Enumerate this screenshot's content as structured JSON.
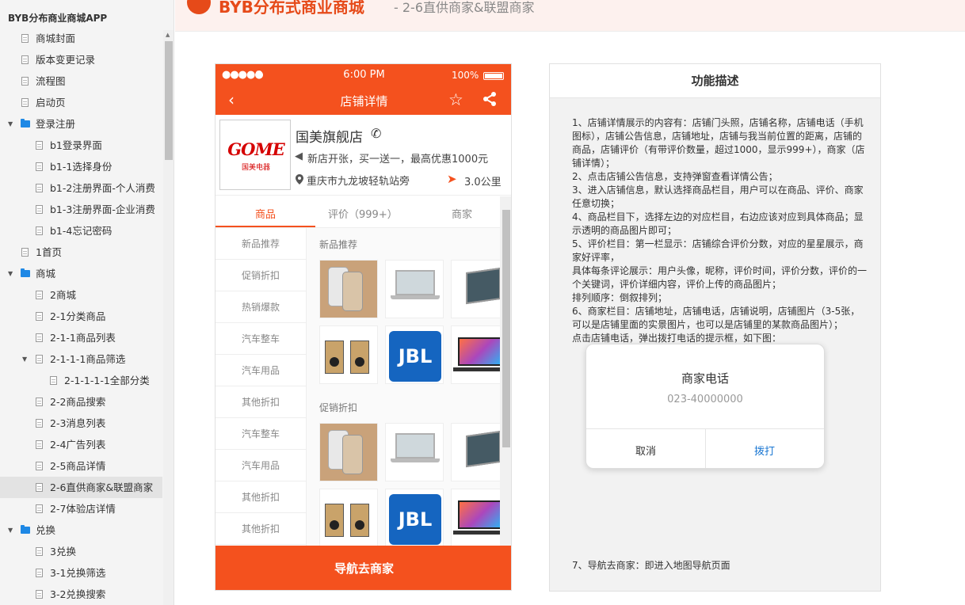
{
  "sidebar": {
    "title": "BYB分布商业商城APP",
    "items": [
      {
        "label": "商城封面",
        "indent": 0,
        "kind": "page",
        "expanded": false
      },
      {
        "label": "版本变更记录",
        "indent": 0,
        "kind": "page",
        "expanded": false
      },
      {
        "label": "流程图",
        "indent": 0,
        "kind": "page",
        "expanded": false
      },
      {
        "label": "启动页",
        "indent": 0,
        "kind": "page",
        "expanded": false
      },
      {
        "label": "登录注册",
        "indent": 0,
        "kind": "folder",
        "expanded": true
      },
      {
        "label": "b1登录界面",
        "indent": 1,
        "kind": "page",
        "expanded": false
      },
      {
        "label": "b1-1选择身份",
        "indent": 1,
        "kind": "page",
        "expanded": false
      },
      {
        "label": "b1-2注册界面-个人消费",
        "indent": 1,
        "kind": "page",
        "expanded": false
      },
      {
        "label": "b1-3注册界面-企业消费",
        "indent": 1,
        "kind": "page",
        "expanded": false
      },
      {
        "label": "b1-4忘记密码",
        "indent": 1,
        "kind": "page",
        "expanded": false
      },
      {
        "label": "1首页",
        "indent": 0,
        "kind": "page",
        "expanded": false
      },
      {
        "label": "商城",
        "indent": 0,
        "kind": "folder",
        "expanded": true
      },
      {
        "label": "2商城",
        "indent": 1,
        "kind": "page",
        "expanded": false
      },
      {
        "label": "2-1分类商品",
        "indent": 1,
        "kind": "page",
        "expanded": false
      },
      {
        "label": "2-1-1商品列表",
        "indent": 1,
        "kind": "page",
        "expanded": false
      },
      {
        "label": "2-1-1-1商品筛选",
        "indent": 1,
        "kind": "page",
        "expanded": true
      },
      {
        "label": "2-1-1-1-1全部分类",
        "indent": 2,
        "kind": "page",
        "expanded": false
      },
      {
        "label": "2-2商品搜索",
        "indent": 1,
        "kind": "page",
        "expanded": false
      },
      {
        "label": "2-3消息列表",
        "indent": 1,
        "kind": "page",
        "expanded": false
      },
      {
        "label": "2-4广告列表",
        "indent": 1,
        "kind": "page",
        "expanded": false
      },
      {
        "label": "2-5商品详情",
        "indent": 1,
        "kind": "page",
        "expanded": false
      },
      {
        "label": "2-6直供商家&联盟商家",
        "indent": 1,
        "kind": "page",
        "expanded": false,
        "selected": true
      },
      {
        "label": "2-7体验店详情",
        "indent": 1,
        "kind": "page",
        "expanded": false
      },
      {
        "label": "兑换",
        "indent": 0,
        "kind": "folder",
        "expanded": true
      },
      {
        "label": "3兑换",
        "indent": 1,
        "kind": "page",
        "expanded": false
      },
      {
        "label": "3-1兑换筛选",
        "indent": 1,
        "kind": "page",
        "expanded": false
      },
      {
        "label": "3-2兑换搜索",
        "indent": 1,
        "kind": "page",
        "expanded": false
      }
    ]
  },
  "header": {
    "brand": "BYB分布式商业商城",
    "page_title": "- 2-6直供商家&联盟商家"
  },
  "phone": {
    "status": {
      "signal": "●●●●●",
      "time": "6:00 PM",
      "battery": "100%"
    },
    "nav": {
      "back": "‹",
      "title": "店铺详情",
      "star": "☆",
      "share": "⋘"
    },
    "shop": {
      "logo_text": "GOME",
      "logo_sub": "国美电器",
      "name": "国美旗舰店",
      "phone_icon": "✆",
      "notice_icon": "◀",
      "notice": "新店开张，买一送一，最高优惠1000元",
      "pin_icon": "⚲",
      "address": "重庆市九龙坡轻轨站旁",
      "distance_icon": "➤",
      "distance": "3.0公里"
    },
    "tabs": [
      "商品",
      "评价（999+）",
      "商家"
    ],
    "categories": [
      "新品推荐",
      "促销折扣",
      "热销爆款",
      "汽车整车",
      "汽车用品",
      "其他折扣",
      "汽车整车",
      "汽车用品",
      "其他折扣",
      "其他折扣"
    ],
    "sections": [
      {
        "title": "新品推荐",
        "products": [
          "phone",
          "laptop",
          "tablet",
          "speaker",
          "jbl",
          "laptop2"
        ]
      },
      {
        "title": "促销折扣",
        "products": [
          "phone",
          "laptop",
          "tablet",
          "speaker",
          "jbl",
          "laptop2"
        ]
      }
    ],
    "jbl_label": "JBL",
    "nav_button": "导航去商家"
  },
  "description": {
    "title": "功能描述",
    "lines": [
      "1、店铺详情展示的内容有：店铺门头照，店铺名称，店铺电话（手机图标），店铺公告信息，店铺地址，店铺与我当前位置的距离，店铺的商品，店铺评价（有带评价数量，超过1000，显示999+），商家（店铺详情）；",
      "2、点击店铺公告信息，支持弹窗查看详情公告；",
      "3、进入店铺信息，默认选择商品栏目，用户可以在商品、评价、商家任意切换；",
      "4、商品栏目下，选择左边的对应栏目，右边应该对应到具体商品；显示透明的商品图片即可；",
      "5、评价栏目：第一栏显示：店铺综合评价分数，对应的星星展示，商家好评率，",
      "具体每条评论展示：用户头像，昵称，评价时间，评价分数，评价的一个关键词，评价详细内容，评价上传的商品图片；",
      "排列顺序：倒叙排列；",
      "6、商家栏目：店铺地址，店铺电话，店铺说明，店铺图片（3-5张，可以是店铺里面的实景图片，也可以是店铺里的某款商品图片）；",
      "点击店铺电话，弹出拨打电话的提示框，如下图："
    ],
    "line7": "7、导航去商家：即进入地图导航页面"
  },
  "dialog": {
    "title": "商家电话",
    "number": "023-40000000",
    "cancel": "取消",
    "call": "拨打"
  },
  "colors": {
    "accent": "#f4511e",
    "folder": "#1e88e5",
    "link": "#1976d2"
  }
}
